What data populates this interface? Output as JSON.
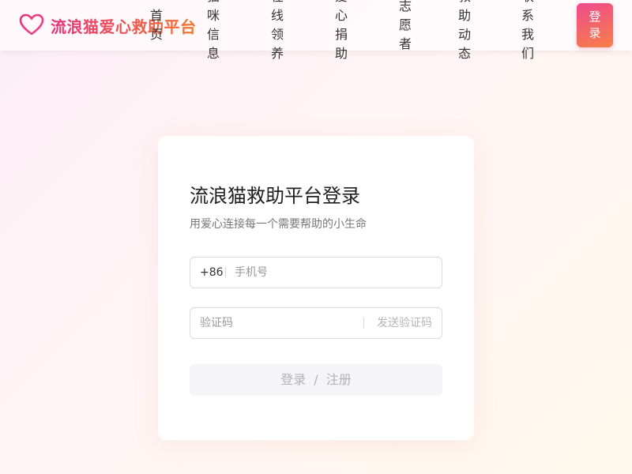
{
  "header": {
    "brand_title": "流浪猫爱心救助平台",
    "nav": [
      {
        "label": "首页"
      },
      {
        "label": "猫咪信息"
      },
      {
        "label": "在线领养"
      },
      {
        "label": "爱心捐助"
      },
      {
        "label": "志愿者"
      },
      {
        "label": "救助动态"
      },
      {
        "label": "联系我们"
      }
    ],
    "login_label": "登录"
  },
  "login_card": {
    "title": "流浪猫救助平台登录",
    "subtitle": "用爱心连接每一个需要帮助的小生命",
    "phone": {
      "prefix": "+86",
      "placeholder": "手机号",
      "value": ""
    },
    "code": {
      "placeholder": "验证码",
      "value": "",
      "send_label": "发送验证码"
    },
    "submit": {
      "login": "登录",
      "separator": "/",
      "register": "注册"
    }
  },
  "colors": {
    "brand_gradient_start": "#e8307a",
    "brand_gradient_end": "#f4762c",
    "button_disabled_bg": "#f5f5f7",
    "button_disabled_text": "#b3b3b3"
  },
  "icons": {
    "brand": "heart-icon"
  }
}
